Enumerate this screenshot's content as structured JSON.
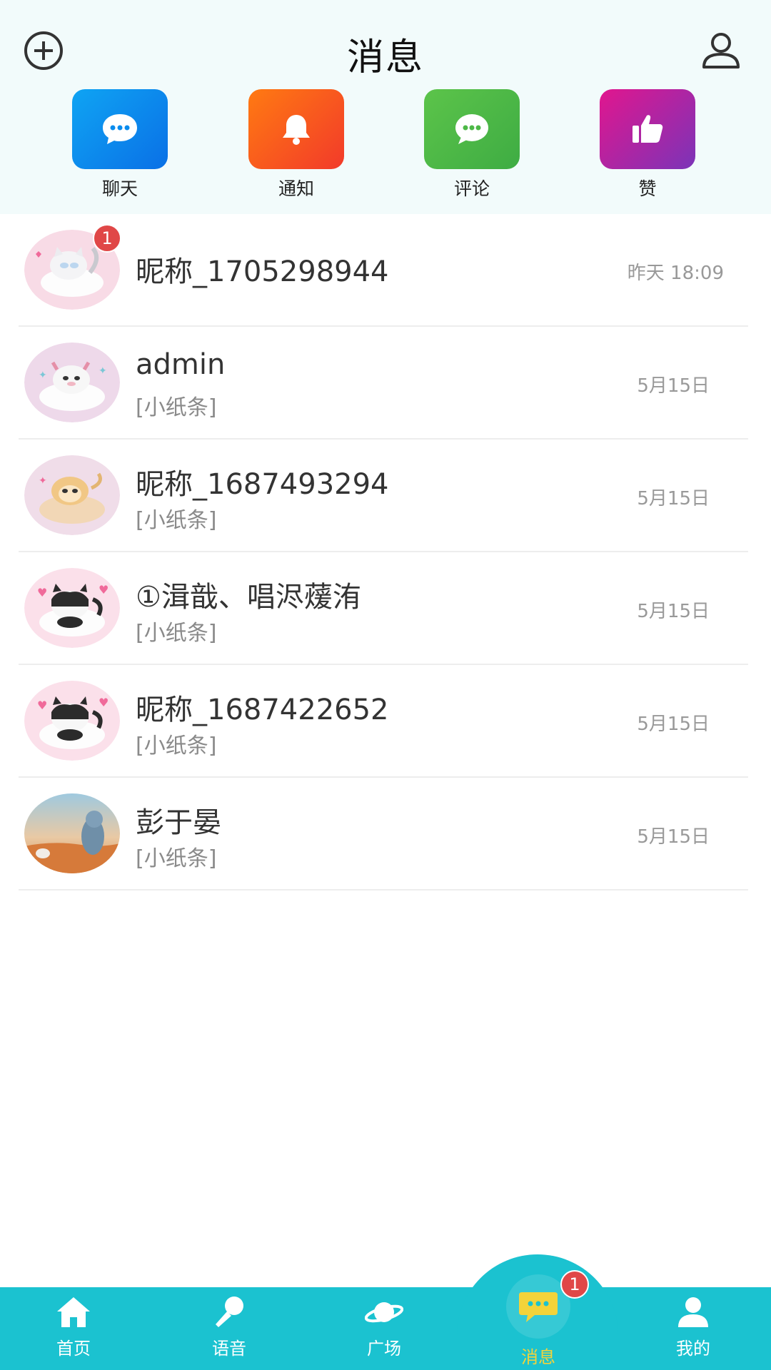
{
  "header": {
    "title": "消息",
    "left_icon": "add-circle-icon",
    "right_icon": "user-icon"
  },
  "quick_actions": [
    {
      "label": "聊天",
      "icon": "chat-bubble-icon",
      "color": "#0a8cee"
    },
    {
      "label": "通知",
      "icon": "bell-icon",
      "color": "#f85a1e"
    },
    {
      "label": "评论",
      "icon": "comment-icon",
      "color": "#4db847"
    },
    {
      "label": "赞",
      "icon": "thumbs-up-icon",
      "color": "#b0259f"
    }
  ],
  "conversations": [
    {
      "name": "昵称_1705298944",
      "preview": "",
      "time": "昨天 18:09",
      "unread": "1",
      "avatar": "white-cat-cloud-avatar"
    },
    {
      "name": "admin",
      "preview": "[小纸条]",
      "time": "5月15日",
      "unread": "",
      "avatar": "white-deer-cloud-avatar"
    },
    {
      "name": "昵称_1687493294",
      "preview": "[小纸条]",
      "time": "5月15日",
      "unread": "",
      "avatar": "monkey-cloud-avatar"
    },
    {
      "name": "①湒戠、唱浕蕿洧",
      "preview": "[小纸条]",
      "time": "5月15日",
      "unread": "",
      "avatar": "black-white-cat-avatar"
    },
    {
      "name": "昵称_1687422652",
      "preview": "[小纸条]",
      "time": "5月15日",
      "unread": "",
      "avatar": "black-white-cat-avatar"
    },
    {
      "name": "彭于晏",
      "preview": "[小纸条]",
      "time": "5月15日",
      "unread": "",
      "avatar": "desert-cat-avatar"
    }
  ],
  "bottom_nav": [
    {
      "label": "首页",
      "icon": "home-icon"
    },
    {
      "label": "语音",
      "icon": "microphone-icon"
    },
    {
      "label": "广场",
      "icon": "planet-icon"
    },
    {
      "label": "消息",
      "icon": "message-bubble-icon",
      "active": true,
      "badge": "1"
    },
    {
      "label": "我的",
      "icon": "person-icon"
    }
  ],
  "colors": {
    "header_bg": "#f2fbfb",
    "nav_bg": "#1bc2d0",
    "nav_active": "#f3d33a",
    "badge": "#e04747"
  }
}
